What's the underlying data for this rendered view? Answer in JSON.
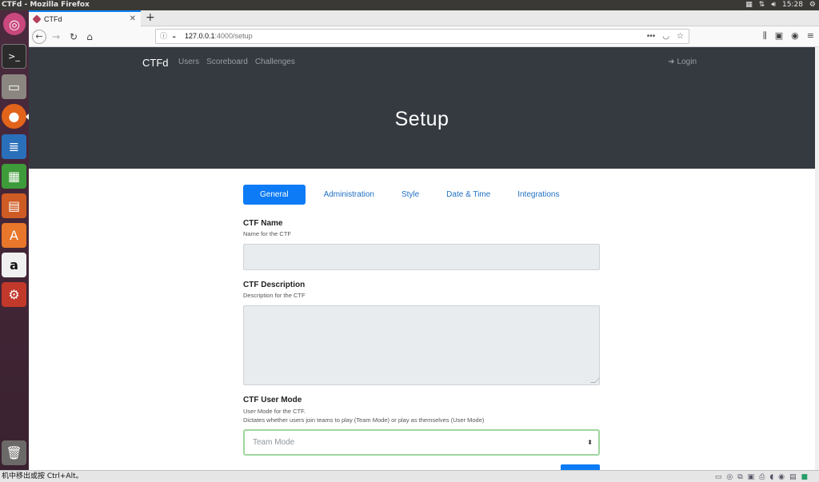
{
  "system": {
    "window_title": "CTFd - Mozilla Firefox",
    "clock": "15:28",
    "tray_icons": [
      "keyboard-icon",
      "network-icon",
      "volume-icon",
      "gear-icon"
    ]
  },
  "launcher": {
    "items": [
      "ubuntu-dash-icon",
      "terminal-icon",
      "files-icon",
      "firefox-icon",
      "writer-icon",
      "calc-icon",
      "impress-icon",
      "software-center-icon",
      "amazon-icon",
      "settings-icon",
      "trash-icon"
    ]
  },
  "browser": {
    "tab_title": "CTFd",
    "url_host": "127.0.0.1",
    "url_path": ":4000/setup"
  },
  "site": {
    "brand": "CTFd",
    "nav": [
      "Users",
      "Scoreboard",
      "Challenges"
    ],
    "login": "Login",
    "heading": "Setup"
  },
  "setup_tabs": {
    "items": [
      "General",
      "Administration",
      "Style",
      "Date & Time",
      "Integrations"
    ],
    "active": "General"
  },
  "form": {
    "ctf_name": {
      "label": "CTF Name",
      "help": "Name for the CTF",
      "value": ""
    },
    "ctf_description": {
      "label": "CTF Description",
      "help": "Description for the CTF",
      "value": ""
    },
    "ctf_user_mode": {
      "label": "CTF User Mode",
      "help_line1": "User Mode for the CTF.",
      "help_line2": "Dictates whether users join teams to play (Team Mode) or play as themselves (User Mode)",
      "selected": "Team Mode"
    }
  },
  "vm_status": {
    "message": "机中移出或按 Ctrl+Alt。"
  }
}
